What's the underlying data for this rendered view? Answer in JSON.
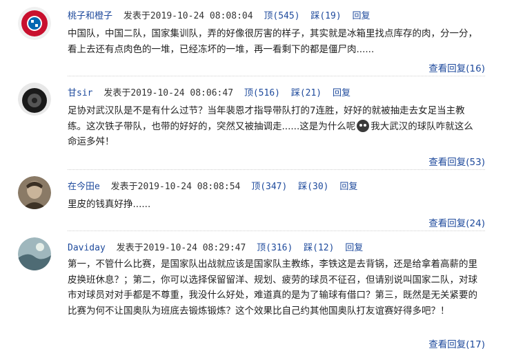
{
  "comments": [
    {
      "username": "桃子和橙子",
      "posted": "发表于2019-10-24 08:08:04",
      "up": "顶(545)",
      "down": "踩(19)",
      "reply": "回复",
      "text": "中国队，中国二队，国家集训队，弄的好像很厉害的样子，其实就是冰箱里找点库存的肉，分一分，看上去还有点肉色的一堆，已经冻坏的一堆，再一看剩下的都是僵尸肉......",
      "view_replies": "查看回复(16)",
      "avatar_color": "#c8102e"
    },
    {
      "username": "甘sir",
      "posted": "发表于2019-10-24 08:06:47",
      "up": "顶(516)",
      "down": "踩(21)",
      "reply": "回复",
      "text_a": "足协对武汉队是不是有什么过节？当年裴恩才指导带队打的7连胜，好好的就被抽走去女足当主教练。这次铁子带队，也带的好好的，突然又被抽调走......这是为什么呢",
      "text_b": "我大武汉的球队咋就这么命运多舛！",
      "view_replies": "查看回复(53)",
      "avatar_color": "#1a1a1a"
    },
    {
      "username": "在今田e",
      "posted": "发表于2019-10-24 08:08:54",
      "up": "顶(347)",
      "down": "踩(30)",
      "reply": "回复",
      "text": "里皮的钱真好挣......",
      "view_replies": "查看回复(24)",
      "avatar_color": "#6b5a45"
    },
    {
      "username": "Daviday",
      "posted": "发表于2019-10-24 08:29:47",
      "up": "顶(316)",
      "down": "踩(12)",
      "reply": "回复",
      "text": "第一，不管什么比赛，是国家队出战就应该是国家队主教练，李铁这是去背锅，还是给拿着高薪的里皮换班休息？；第二，你可以选择保留留洋、规划、疲劳的球员不征召，但请别说叫国家二队，对球市对球员对对手都是不尊重，我没什么好处，难道真的是为了输球有借口？第三，既然是无关紧要的比赛为何不让国奥队为班底去锻炼锻炼？这个效果比自己约其他国奥队打友谊赛好得多吧？！",
      "view_replies": "查看回复(17)",
      "avatar_color": "#4e6b74"
    }
  ]
}
